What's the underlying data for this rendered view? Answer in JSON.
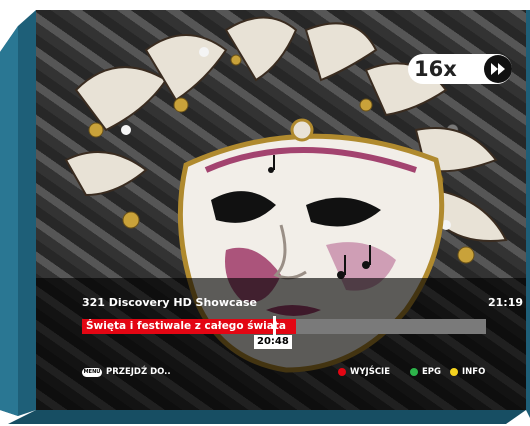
{
  "overlay": {
    "channel": "321 Discovery HD Showcase",
    "clock": "21:19",
    "program": {
      "title": "Święta i festiwale z całego świata",
      "progress": 0.53,
      "position_time": "20:48"
    },
    "speed": {
      "label": "16x",
      "icon": "fast-forward-icon"
    },
    "footer": {
      "menu_key": "MENU",
      "menu_label": "PRZEJDŹ DO..",
      "keys": [
        {
          "color": "#e30613",
          "label": "WYJŚCIE"
        },
        {
          "color": "#2db34a",
          "label": "EPG"
        },
        {
          "color": "#f4d31f",
          "label": "INFO"
        }
      ]
    }
  },
  "colors": {
    "frame": "#1e5f78",
    "accent": "#e30613",
    "track": "#7a7a7a"
  }
}
